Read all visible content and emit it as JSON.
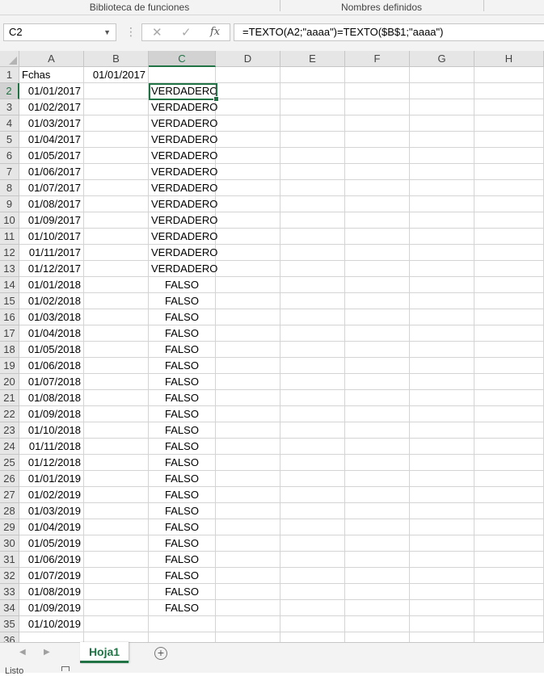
{
  "ribbon": {
    "group_functions": "Biblioteca de funciones",
    "group_names": "Nombres definidos"
  },
  "formula_bar": {
    "name_box": "C2",
    "formula": "=TEXTO(A2;\"aaaa\")=TEXTO($B$1;\"aaaa\")",
    "cancel_icon": "close-icon",
    "enter_icon": "check-icon",
    "fx_label": "fx"
  },
  "columns": [
    "A",
    "B",
    "C",
    "D",
    "E",
    "F",
    "G",
    "H"
  ],
  "selected": {
    "column": "C",
    "row": "2"
  },
  "rows": [
    {
      "n": "1",
      "a": "Fchas",
      "b": "01/01/2017",
      "c": ""
    },
    {
      "n": "2",
      "a": "01/01/2017",
      "b": "",
      "c": "VERDADERO"
    },
    {
      "n": "3",
      "a": "01/02/2017",
      "b": "",
      "c": "VERDADERO"
    },
    {
      "n": "4",
      "a": "01/03/2017",
      "b": "",
      "c": "VERDADERO"
    },
    {
      "n": "5",
      "a": "01/04/2017",
      "b": "",
      "c": "VERDADERO"
    },
    {
      "n": "6",
      "a": "01/05/2017",
      "b": "",
      "c": "VERDADERO"
    },
    {
      "n": "7",
      "a": "01/06/2017",
      "b": "",
      "c": "VERDADERO"
    },
    {
      "n": "8",
      "a": "01/07/2017",
      "b": "",
      "c": "VERDADERO"
    },
    {
      "n": "9",
      "a": "01/08/2017",
      "b": "",
      "c": "VERDADERO"
    },
    {
      "n": "10",
      "a": "01/09/2017",
      "b": "",
      "c": "VERDADERO"
    },
    {
      "n": "11",
      "a": "01/10/2017",
      "b": "",
      "c": "VERDADERO"
    },
    {
      "n": "12",
      "a": "01/11/2017",
      "b": "",
      "c": "VERDADERO"
    },
    {
      "n": "13",
      "a": "01/12/2017",
      "b": "",
      "c": "VERDADERO"
    },
    {
      "n": "14",
      "a": "01/01/2018",
      "b": "",
      "c": "FALSO"
    },
    {
      "n": "15",
      "a": "01/02/2018",
      "b": "",
      "c": "FALSO"
    },
    {
      "n": "16",
      "a": "01/03/2018",
      "b": "",
      "c": "FALSO"
    },
    {
      "n": "17",
      "a": "01/04/2018",
      "b": "",
      "c": "FALSO"
    },
    {
      "n": "18",
      "a": "01/05/2018",
      "b": "",
      "c": "FALSO"
    },
    {
      "n": "19",
      "a": "01/06/2018",
      "b": "",
      "c": "FALSO"
    },
    {
      "n": "20",
      "a": "01/07/2018",
      "b": "",
      "c": "FALSO"
    },
    {
      "n": "21",
      "a": "01/08/2018",
      "b": "",
      "c": "FALSO"
    },
    {
      "n": "22",
      "a": "01/09/2018",
      "b": "",
      "c": "FALSO"
    },
    {
      "n": "23",
      "a": "01/10/2018",
      "b": "",
      "c": "FALSO"
    },
    {
      "n": "24",
      "a": "01/11/2018",
      "b": "",
      "c": "FALSO"
    },
    {
      "n": "25",
      "a": "01/12/2018",
      "b": "",
      "c": "FALSO"
    },
    {
      "n": "26",
      "a": "01/01/2019",
      "b": "",
      "c": "FALSO"
    },
    {
      "n": "27",
      "a": "01/02/2019",
      "b": "",
      "c": "FALSO"
    },
    {
      "n": "28",
      "a": "01/03/2019",
      "b": "",
      "c": "FALSO"
    },
    {
      "n": "29",
      "a": "01/04/2019",
      "b": "",
      "c": "FALSO"
    },
    {
      "n": "30",
      "a": "01/05/2019",
      "b": "",
      "c": "FALSO"
    },
    {
      "n": "31",
      "a": "01/06/2019",
      "b": "",
      "c": "FALSO"
    },
    {
      "n": "32",
      "a": "01/07/2019",
      "b": "",
      "c": "FALSO"
    },
    {
      "n": "33",
      "a": "01/08/2019",
      "b": "",
      "c": "FALSO"
    },
    {
      "n": "34",
      "a": "01/09/2019",
      "b": "",
      "c": "FALSO"
    },
    {
      "n": "35",
      "a": "01/10/2019",
      "b": "",
      "c": ""
    },
    {
      "n": "36",
      "a": "",
      "b": "",
      "c": ""
    }
  ],
  "sheet_tabs": [
    "Hoja1"
  ],
  "status_bar": {
    "text": "Listo"
  },
  "colors": {
    "accent": "#217346",
    "gridline": "#d4d4d4",
    "header_bg": "#e6e6e6"
  }
}
